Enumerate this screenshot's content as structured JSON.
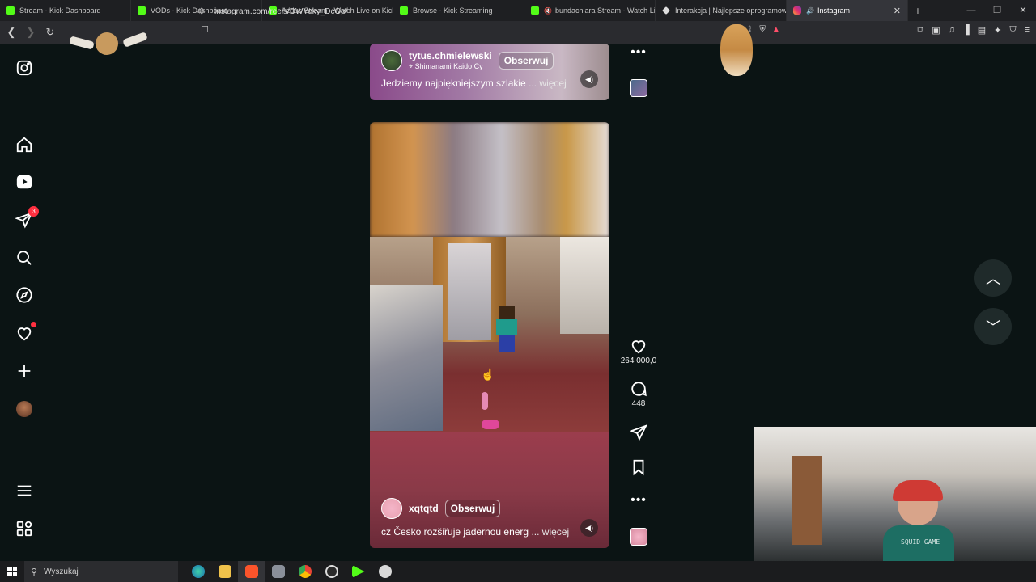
{
  "browser": {
    "tabs": [
      {
        "title": "Stream - Kick Dashboard",
        "icon": "kick-icon"
      },
      {
        "title": "VODs - Kick Dashboard",
        "icon": "kick-icon"
      },
      {
        "title": "Azdus Stream - Watch Live on Kick",
        "icon": "kick-icon"
      },
      {
        "title": "Browse - Kick Streaming",
        "icon": "kick-icon"
      },
      {
        "title": "bundachiara Stream - Watch Live",
        "icon": "kick-icon"
      },
      {
        "title": "Interakcja | Najlepsze oprogramowa",
        "icon": "diamond-icon"
      },
      {
        "title": "Instagram",
        "icon": "instagram-icon"
      }
    ],
    "url": "instagram.com/reels/DWYeky_DcOp/"
  },
  "sidebar": {
    "notifications_badge": "3"
  },
  "reels": [
    {
      "username": "tytus.chmielewski",
      "location": "Shimanami Kaido Cy",
      "follow_label": "Obserwuj",
      "caption": "Jedziemy najpiękniejszym szlakie",
      "more_label": "... więcej"
    },
    {
      "username": "xqtqtd",
      "follow_label": "Obserwuj",
      "caption": "cz Česko rozšiřuje jadernou energ",
      "more_label": "... więcej",
      "likes": "264 000,0",
      "comments": "448"
    }
  ],
  "webcam": {
    "shirt_text": "SQUID GAME"
  },
  "taskbar": {
    "search_placeholder": "Wyszukaj"
  }
}
